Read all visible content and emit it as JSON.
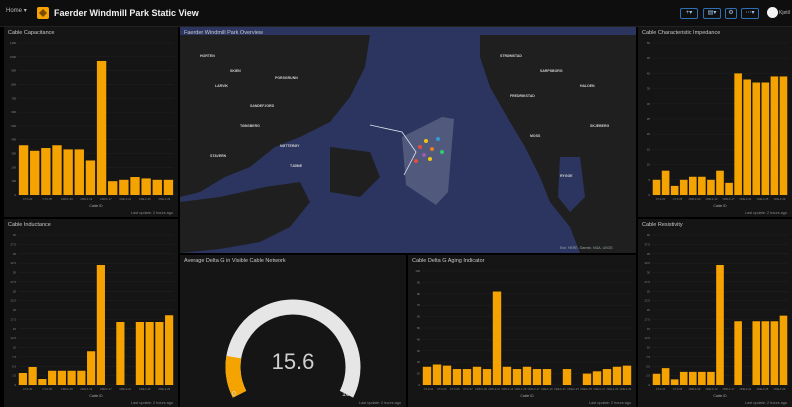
{
  "header": {
    "home_label": "Home",
    "title": "Faerder Windmill Park Static View",
    "user_label": "Kjetil",
    "accent": "#f5a300"
  },
  "map": {
    "title": "Faerder Windmill Park Overview",
    "attribution": "Esri, HERE, Garmin, NGA, USGS",
    "labels": [
      "HORTEN",
      "SKIEN",
      "PORSGRUNN",
      "LARVIK",
      "SANDEFJORD",
      "TØNSBERG",
      "STAVERN",
      "NØTTERØY",
      "TJØME",
      "STRØMSTAD",
      "FREDRIKSTAD",
      "SARPSBORG",
      "HALDEN",
      "MOSS",
      "RYGGE",
      "SKJEBERG"
    ]
  },
  "gauge": {
    "title": "Average Delta G in Visible Cable Network",
    "value": 15.6,
    "value_label": "15.6",
    "min": 0,
    "max": 100,
    "min_label": "0",
    "max_label": "100",
    "footer": "Last update: 2 hours ago"
  },
  "chart_data": [
    {
      "id": "capacitance",
      "type": "bar",
      "title": "Cable Capacitance",
      "xlabel": "Cable ID",
      "ylabel": "",
      "footer": "Last update: 2 hours ago",
      "ylim": [
        0,
        110
      ],
      "yticks": [
        "0",
        "100",
        "200",
        "300",
        "400",
        "500",
        "600",
        "700",
        "800",
        "900",
        "1000",
        "1100"
      ],
      "xticks": [
        "CT-F-01",
        "CT-F-05",
        "CDD-F-09",
        "CDD-F-13",
        "CDD-F-17",
        "CDE-F-21",
        "CDE-F-25",
        "CDE-F-29"
      ],
      "values": [
        36,
        32,
        34,
        36,
        33,
        33,
        25,
        97,
        10,
        11,
        13,
        12,
        11,
        11
      ]
    },
    {
      "id": "inductance",
      "type": "bar",
      "title": "Cable Inductance",
      "xlabel": "Cable ID",
      "ylabel": "",
      "footer": "Last update: 2 hours ago",
      "ylim": [
        0,
        40
      ],
      "yticks": [
        "0",
        "2.5",
        "5.0",
        "7.5",
        "10",
        "12.5",
        "15",
        "17.5",
        "20",
        "22.5",
        "25",
        "27.5",
        "30",
        "32.5",
        "35",
        "37.5",
        "40"
      ],
      "xticks": [
        "CT-F-01",
        "CT-F-05",
        "CDD-F-09",
        "CDD-F-13",
        "CDD-F-17",
        "CDE-F-21",
        "CDE-F-25",
        "CDE-F-29"
      ],
      "values": [
        3.2,
        4.8,
        1.6,
        3.8,
        3.8,
        3.8,
        3.8,
        9,
        32,
        0,
        16.8,
        0,
        16.8,
        16.8,
        16.8,
        18.6
      ]
    },
    {
      "id": "impedance",
      "type": "bar",
      "title": "Cable Characteristic Impedance",
      "xlabel": "Cable ID",
      "ylabel": "",
      "footer": "Last update: 2 hours ago",
      "ylim": [
        0,
        50
      ],
      "yticks": [
        "0",
        "5",
        "10",
        "15",
        "20",
        "25",
        "30",
        "35",
        "40",
        "45",
        "50"
      ],
      "xticks": [
        "CT-F-01",
        "CT-F-05",
        "CDD-F-09",
        "CDD-F-13",
        "CDD-F-17",
        "CDE-F-21",
        "CDE-F-25",
        "CDE-F-29"
      ],
      "values": [
        5,
        8,
        3,
        5,
        6,
        6,
        5,
        8,
        4,
        40,
        38,
        37,
        37,
        39,
        39
      ]
    },
    {
      "id": "resistivity",
      "type": "bar",
      "title": "Cable Resistivity",
      "xlabel": "Cable ID",
      "ylabel": "",
      "footer": "Last update: 2 hours ago",
      "ylim": [
        0,
        40
      ],
      "yticks": [
        "0",
        "2.5",
        "5.0",
        "7.5",
        "10",
        "12.5",
        "15",
        "17.5",
        "20",
        "22.5",
        "25",
        "27.5",
        "30",
        "32.5",
        "35",
        "37.5",
        "40"
      ],
      "xticks": [
        "CT-F-01",
        "CT-F-05",
        "CDD-F-09",
        "CDD-F-13",
        "CDD-F-17",
        "CDE-F-21",
        "CDE-F-25",
        "CDE-F-29"
      ],
      "values": [
        3,
        4.5,
        1.5,
        3.5,
        3.5,
        3.5,
        3.5,
        32,
        0,
        17,
        0,
        17,
        17,
        17,
        18.5
      ]
    },
    {
      "id": "aging",
      "type": "bar",
      "title": "Cable Delta G Aging Indicator",
      "xlabel": "Cable ID",
      "ylabel": "",
      "footer": "Last update: 2 hours ago",
      "ylim": [
        0,
        100
      ],
      "yticks": [
        "0",
        "10",
        "20",
        "30",
        "40",
        "50",
        "60",
        "70",
        "80",
        "90",
        "100"
      ],
      "xticks": [
        "CT-F-01",
        "CT-F-03",
        "CT-F-05",
        "CT-F-07",
        "CDD-F-09",
        "CDD-F-11",
        "CDD-F-13",
        "CDD-F-15",
        "CDD-F-17",
        "CDE-F-19",
        "CDE-F-21",
        "CDE-F-23",
        "CDE-F-25",
        "CDE-F-27",
        "CDE-F-29",
        "CDE-F-31"
      ],
      "values": [
        16,
        18,
        17,
        14,
        14,
        16,
        14,
        82,
        16,
        14,
        16,
        14,
        14,
        0,
        14,
        0,
        10,
        12,
        14,
        16,
        17
      ]
    }
  ]
}
